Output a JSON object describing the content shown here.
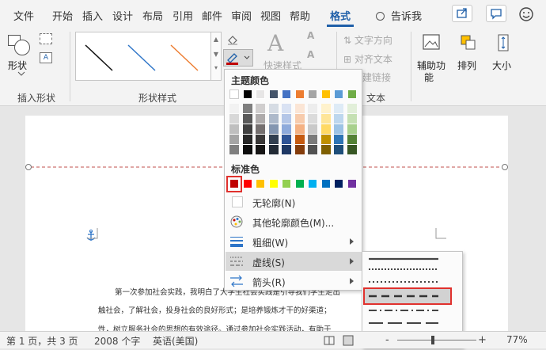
{
  "tabs": [
    "文件",
    "开始",
    "插入",
    "设计",
    "布局",
    "引用",
    "邮件",
    "审阅",
    "视图",
    "帮助",
    "格式"
  ],
  "active_tab": "格式",
  "search_label": "告诉我",
  "ribbon": {
    "insert_shapes": {
      "shape_label": "形状",
      "group_label": "插入形状"
    },
    "shape_styles": {
      "group_label": "形状样式",
      "gallery_colors": [
        "#111111",
        "#2e75c8",
        "#ed7d31"
      ]
    },
    "wordart": {
      "quick_styles": "快速样式",
      "group_label": "文本"
    },
    "text": {
      "direction": "文字方向",
      "align": "对齐文本",
      "link": "创建链接"
    },
    "arrange": {
      "accessibility": "辅助功",
      "accessibility2": "能",
      "arrange": "排列",
      "size": "大小"
    }
  },
  "outline_menu": {
    "theme_colors_title": "主题颜色",
    "theme_top_row": [
      "#ffffff",
      "#000000",
      "#e7e6e6",
      "#44546a",
      "#4472c4",
      "#ed7d31",
      "#a5a5a5",
      "#ffc000",
      "#5b9bd5",
      "#70ad47"
    ],
    "theme_shades": [
      [
        "#f2f2f2",
        "#7f7f7f",
        "#d0cece",
        "#d6dce4",
        "#d9e2f3",
        "#fbe5d5",
        "#ededed",
        "#fff2cc",
        "#deebf6",
        "#e2efd9"
      ],
      [
        "#d8d8d8",
        "#595959",
        "#aeabab",
        "#adb9ca",
        "#b4c6e7",
        "#f7cbac",
        "#dbdbdb",
        "#fee599",
        "#bdd7ee",
        "#c5e0b3"
      ],
      [
        "#bfbfbf",
        "#3f3f3f",
        "#757070",
        "#8496b0",
        "#8eaadb",
        "#f4b183",
        "#c9c9c9",
        "#ffd965",
        "#9cc3e5",
        "#a8d08d"
      ],
      [
        "#a5a5a5",
        "#262626",
        "#3a3838",
        "#323f4f",
        "#2f5496",
        "#c55a11",
        "#7b7b7b",
        "#bf9000",
        "#2e75b5",
        "#538135"
      ],
      [
        "#7f7f7f",
        "#0c0c0c",
        "#171616",
        "#222a35",
        "#1e3864",
        "#843c0b",
        "#525252",
        "#7f6000",
        "#1e4e79",
        "#375623"
      ]
    ],
    "standard_title": "标准色",
    "standard_colors": [
      "#c00000",
      "#ff0000",
      "#ffc000",
      "#ffff00",
      "#92d050",
      "#00b050",
      "#00b0f0",
      "#0070c0",
      "#002060",
      "#7030a0"
    ],
    "no_outline": "无轮廓(N)",
    "more_colors": "其他轮廓颜色(M)...",
    "weight": "粗细(W)",
    "dashes": "虚线(S)",
    "arrows": "箭头(R)"
  },
  "document": {
    "line1": "第一次参加社会实践，我明白了大学生社会实践是引导我们学生走出",
    "line2": "触社会，了解社会，投身社会的良好形式；是培养锻炼才干的好渠道；",
    "line3": "性，树立服务社会的思想的有效途径。通过参加社会实践活动，有助于"
  },
  "status": {
    "page": "第 1 页，共 3 页",
    "words": "2008 个字",
    "language": "英语(美国)",
    "zoom": "77%",
    "zoom_minus": "-",
    "zoom_plus": "+"
  }
}
